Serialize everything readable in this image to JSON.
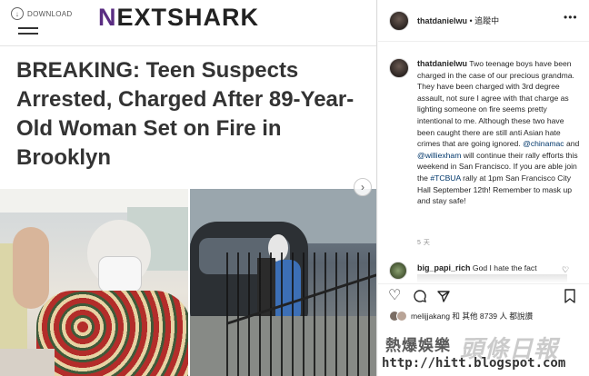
{
  "article": {
    "download_label": "DOWNLOAD",
    "logo_prefix": "N",
    "logo_rest": "EXTSHARK",
    "headline": "BREAKING: Teen Suspects Arrested, Charged After 89-Year-Old Woman Set on Fire in Brooklyn",
    "next_arrow": "›"
  },
  "post": {
    "username": "thatdanielwu",
    "follow_status": "• 追蹤中",
    "more": "•••",
    "caption_parts": {
      "p1": "Two teenage boys have been charged in the case of our precious grandma. They have been charged with 3rd degree assault, not sure I agree with that charge as lighting someone on fire seems pretty intentional to me. Although these two have been caught there are still anti Asian hate crimes that are going ignored. ",
      "m1": "@chinamac",
      "p2": " and ",
      "m2": "@williexham",
      "p3": " will continue their rally efforts this weekend in San Francisco. If you are able join the ",
      "m3": "#TCBUA",
      "p4": " rally at 1pm San Francisco City Hall September 12th! Remember to mask up and stay safe!"
    },
    "age": "5 天",
    "comment": {
      "username": "big_papi_rich",
      "text": "God I hate the fact"
    },
    "likes_text": "melijjakang 和 其他 8739 人 都說讚"
  },
  "watermark": {
    "line1": "熱爆娛樂",
    "line2": "頭條日報",
    "url": "http://hitt.blogspot.com"
  },
  "colors": {
    "logo_accent": "#5a2d82",
    "mention": "#00376b",
    "text": "#262626"
  }
}
